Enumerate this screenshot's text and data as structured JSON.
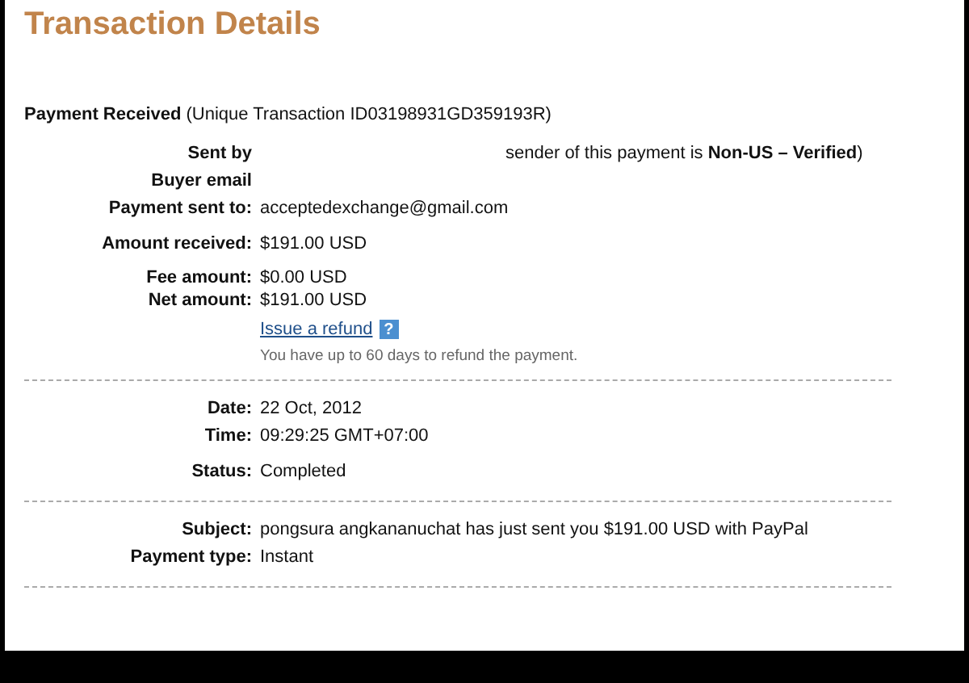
{
  "title": "Transaction Details",
  "payment_header": {
    "label": "Payment Received",
    "detail": "(Unique Transaction ID03198931GD359193R)"
  },
  "sections": [
    {
      "groups": [
        {
          "rows": [
            {
              "label": "Sent by",
              "value": "sender of this payment is **Non-US – Verified**)",
              "redacted": true
            },
            {
              "label": "Buyer email",
              "redacted": true
            },
            {
              "label": "Payment sent to:",
              "value": "acceptedexchange@gmail.com"
            }
          ]
        },
        {
          "rows": [
            {
              "label": "Amount received:",
              "value": "$191.00 USD"
            }
          ]
        },
        {
          "rows": [
            {
              "label": "Fee amount:",
              "value": "$0.00 USD"
            },
            {
              "label": "Net amount:",
              "value": "$191.00 USD"
            }
          ]
        }
      ],
      "refund": {
        "link": "Issue a refund",
        "help": "?",
        "note": "You have up to 60 days to refund the payment."
      }
    },
    {
      "groups": [
        {
          "rows": [
            {
              "label": "Date:",
              "value": "22 Oct, 2012"
            },
            {
              "label": "Time:",
              "value": "09:29:25 GMT+07:00"
            }
          ]
        },
        {
          "rows": [
            {
              "label": "Status:",
              "value": "Completed"
            }
          ]
        }
      ]
    },
    {
      "groups": [
        {
          "rows": [
            {
              "label": "Subject:",
              "value": "pongsura angkananuchat has just sent you $191.00 USD with PayPal"
            },
            {
              "label": "Payment type:",
              "value": "Instant"
            }
          ]
        }
      ]
    }
  ]
}
